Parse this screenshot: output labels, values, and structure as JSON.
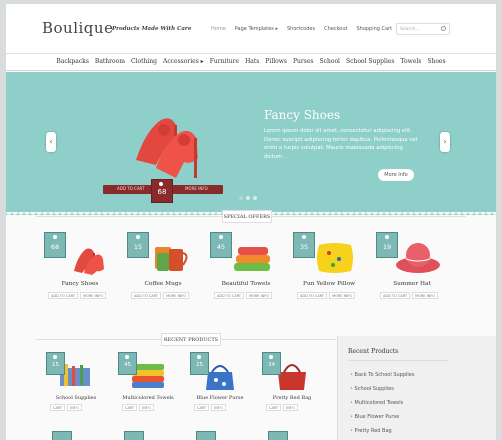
{
  "brand": {
    "logo": "Boulique",
    "tagline": "Products Made With Care"
  },
  "top_nav": [
    {
      "label": "Home",
      "active": true
    },
    {
      "label": "Page Templates ▸",
      "active": false
    },
    {
      "label": "Shortcodes",
      "active": false
    },
    {
      "label": "Checkout",
      "active": false
    },
    {
      "label": "Shopping Cart",
      "active": false
    }
  ],
  "search": {
    "placeholder": "Search..."
  },
  "categories": [
    "Backpacks",
    "Bathroom",
    "Clothing",
    "Accessories ▸",
    "Furniture",
    "Hats",
    "Pillows",
    "Purses",
    "School",
    "School Supplies",
    "Towels",
    "Shoes"
  ],
  "slider": {
    "title": "Fancy Shoes",
    "text": "Lorem ipsum dolor sit amet, consectetur adipiscing elit. Donec suscipit adipiscing tortor dapibus. Pellentesque vel enim a turpis volutpat. Mauris malesuada adipiscing dictum.",
    "more_label": "More Info",
    "add_to_cart_label": "ADD TO CART",
    "more_info_label": "MORE INFO",
    "price": "68",
    "prev_label": "‹",
    "next_label": "›"
  },
  "special_offers": {
    "label": "SPECIAL OFFERS",
    "add_label": "ADD TO CART",
    "more_label": "MORE INFO",
    "items": [
      {
        "name": "Fancy Shoes",
        "price": "68"
      },
      {
        "name": "Coffee Mugs",
        "price": "15"
      },
      {
        "name": "Beautiful Towels",
        "price": "45"
      },
      {
        "name": "Fun Yellow Pillow",
        "price": "35"
      },
      {
        "name": "Summer Hat",
        "price": "19"
      }
    ]
  },
  "recent_products": {
    "label": "RECENT PRODUCTS",
    "cart_label": "CART",
    "info_label": "INFO",
    "items": [
      {
        "name": "School Supplies",
        "price": "15"
      },
      {
        "name": "Multicolored Towels",
        "price": "45"
      },
      {
        "name": "Blue Flower Purse",
        "price": "25"
      },
      {
        "name": "Pretty Red Bag",
        "price": "34"
      }
    ]
  },
  "sidebar": {
    "title": "Recent Products",
    "items": [
      "Back To School Supplies",
      "School Supplies",
      "Multicolored Towels",
      "Blue Flower Purse",
      "Pretty Red Bag"
    ]
  },
  "colors": {
    "accent": "#8fcfca",
    "tag": "#7db8b4",
    "wine": "#8a2b2b"
  }
}
